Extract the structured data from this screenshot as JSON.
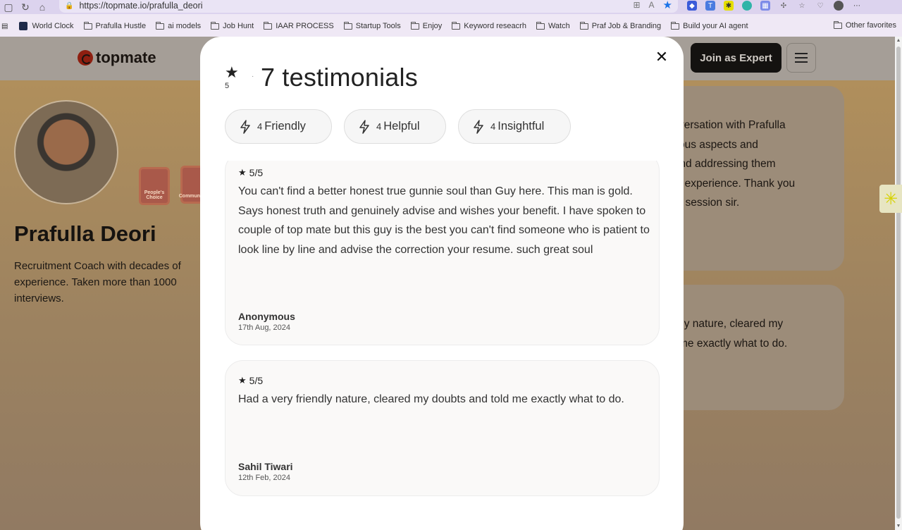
{
  "browser": {
    "url": "https://topmate.io/prafulla_deori",
    "bookmarks": [
      "World Clock",
      "Prafulla Hustle",
      "ai models",
      "Job Hunt",
      "IAAR PROCESS",
      "Startup Tools",
      "Enjoy",
      "Keyword reseacrh",
      "Watch",
      "Praf Job & Branding",
      "Build your AI agent"
    ],
    "other_favorites": "Other favorites"
  },
  "header": {
    "logo_text": "topmate",
    "join_label": "Join as Expert"
  },
  "profile": {
    "name": "Prafulla Deori",
    "bio": "Recruitment Coach with decades of experience. Taken more than 1000 interviews.",
    "badges": [
      "People's Choice",
      "Community"
    ]
  },
  "background_cards": [
    {
      "lines": [
        "conversation with Prafulla",
        "various aspects and",
        "IT and addressing them",
        "onal experience. Thank you",
        "erful session sir."
      ]
    },
    {
      "lines": [
        "iendly nature, cleared my",
        "old me exactly what to do."
      ]
    }
  ],
  "modal": {
    "rating": "5",
    "testimonial_count": "7 testimonials",
    "chips": [
      {
        "count": "4",
        "label": "Friendly"
      },
      {
        "count": "4",
        "label": "Helpful"
      },
      {
        "count": "4",
        "label": "Insightful"
      }
    ],
    "testimonials": [
      {
        "rating": "5/5",
        "text": "You can't find a better honest true gunnie soul than Guy here. This man is gold. Says honest truth and genuinely advise and wishes your benefit. I have spoken to couple of top mate but this guy is the best you can't find someone who is patient to look line by line and advise the correction your resume. such great soul",
        "author": "Anonymous",
        "date": "17th Aug, 2024"
      },
      {
        "rating": "5/5",
        "text": "Had a very friendly nature, cleared my doubts and told me exactly what to do.",
        "author": "Sahil Tiwari",
        "date": "12th Feb, 2024"
      }
    ]
  }
}
